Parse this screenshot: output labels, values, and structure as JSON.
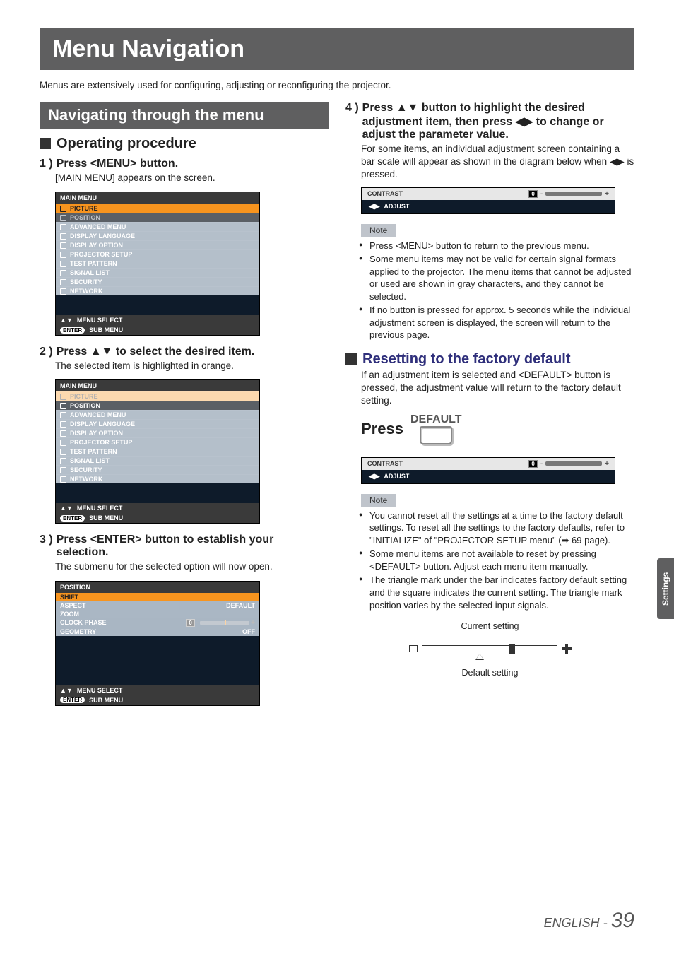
{
  "title": "Menu Navigation",
  "intro": "Menus are extensively used for configuring, adjusting or reconfiguring the projector.",
  "sidebar_tab": "Settings",
  "footer": {
    "lang": "ENGLISH - ",
    "page": "39"
  },
  "left": {
    "section_bar": "Navigating through the menu",
    "op_procedure": "Operating procedure",
    "step1": {
      "n": "1 )",
      "title": " Press <MENU> button.",
      "desc": "[MAIN MENU] appears on the screen."
    },
    "menu1": {
      "head": "MAIN MENU",
      "items": [
        "PICTURE",
        "POSITION",
        "ADVANCED MENU",
        "DISPLAY LANGUAGE",
        "DISPLAY OPTION",
        "PROJECTOR SETUP",
        "TEST PATTERN",
        "SIGNAL LIST",
        "SECURITY",
        "NETWORK"
      ],
      "active_index": 0,
      "foot1": "MENU SELECT",
      "foot2_pill": "ENTER",
      "foot2": "SUB MENU"
    },
    "step2": {
      "n": "2 )",
      "title": " Press ▲▼ to select the desired item.",
      "desc": "The selected item is highlighted in orange."
    },
    "menu2": {
      "head": "MAIN MENU",
      "items": [
        "PICTURE",
        "POSITION",
        "ADVANCED MENU",
        "DISPLAY LANGUAGE",
        "DISPLAY OPTION",
        "PROJECTOR SETUP",
        "TEST PATTERN",
        "SIGNAL LIST",
        "SECURITY",
        "NETWORK"
      ],
      "active_index": 1,
      "foot1": "MENU SELECT",
      "foot2_pill": "ENTER",
      "foot2": "SUB MENU"
    },
    "step3": {
      "n": "3 )",
      "title": " Press <ENTER> button to establish your selection.",
      "desc": "The submenu for the selected option will now open."
    },
    "submenu": {
      "head": "POSITION",
      "rows": [
        {
          "k": "SHIFT",
          "v": "",
          "sel": true
        },
        {
          "k": "ASPECT",
          "v": "DEFAULT"
        },
        {
          "k": "ZOOM",
          "v": ""
        },
        {
          "k": "CLOCK PHASE",
          "v": "0",
          "bar": true
        },
        {
          "k": "GEOMETRY",
          "v": "OFF"
        }
      ],
      "foot1": "MENU SELECT",
      "foot2_pill": "ENTER",
      "foot2": "SUB MENU"
    }
  },
  "right": {
    "step4": {
      "n": "4 )",
      "title": " Press ▲▼ button to highlight the desired adjustment item, then press ◀▶ to change or adjust the parameter value.",
      "desc": "For some items, an individual adjustment screen containing a bar scale will appear as shown in the diagram below when ◀▶ is pressed."
    },
    "contrast": {
      "label": "CONTRAST",
      "value": "0",
      "adjust": "ADJUST"
    },
    "note_label": "Note",
    "notes1": [
      "Press <MENU> button to return to the previous menu.",
      "Some menu items may not be valid for certain signal formats applied to the projector. The menu items that cannot be adjusted or used are shown in gray characters, and they cannot be selected.",
      "If no button is pressed for approx. 5 seconds while the individual adjustment screen is displayed, the screen will return to the previous page."
    ],
    "reset_head": "Resetting to the factory default",
    "reset_para": "If an adjustment item is selected and <DEFAULT> button is pressed, the adjustment value will return to the factory default setting.",
    "press": "Press",
    "key_label": "DEFAULT",
    "contrast2": {
      "label": "CONTRAST",
      "value": "0",
      "adjust": "ADJUST"
    },
    "notes2": [
      "You cannot reset all the settings at a time to the factory default settings. To reset all the settings to the factory defaults, refer to \"INITIALIZE\" of \"PROJECTOR SETUP menu\" (➡ 69 page).",
      "Some menu items are not available to reset by pressing <DEFAULT> button. Adjust each menu item manually.",
      "The triangle mark under the bar indicates factory default setting and the square indicates the current setting. The triangle mark position varies by the selected input signals."
    ],
    "diag": {
      "top": "Current setting",
      "bot": "Default setting"
    }
  }
}
